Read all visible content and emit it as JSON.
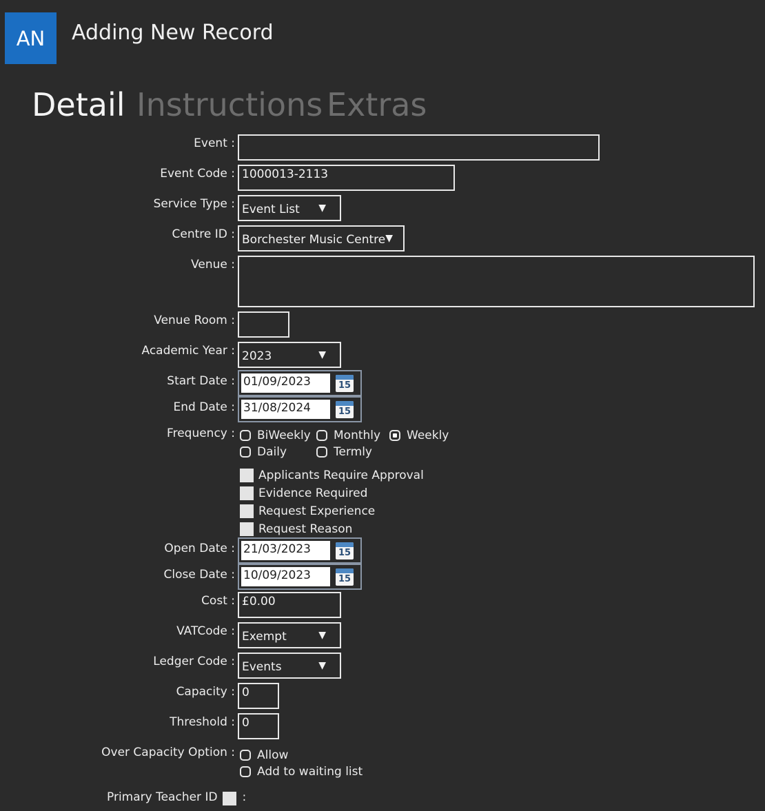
{
  "header": {
    "avatar_initials": "AN",
    "title": "Adding New Record"
  },
  "tabs": {
    "detail": "Detail",
    "instructions": "Instructions",
    "extras": "Extras"
  },
  "form": {
    "event": {
      "label": "Event :",
      "value": ""
    },
    "event_code": {
      "label": "Event Code :",
      "value": "1000013-2113"
    },
    "service_type": {
      "label": "Service Type :",
      "value": "Event List"
    },
    "centre_id": {
      "label": "Centre ID :",
      "value": "Borchester Music Centre"
    },
    "venue": {
      "label": "Venue :",
      "value": ""
    },
    "venue_room": {
      "label": "Venue Room :",
      "value": ""
    },
    "academic_year": {
      "label": "Academic Year :",
      "value": "2023"
    },
    "start_date": {
      "label": "Start Date :",
      "value": "01/09/2023"
    },
    "end_date": {
      "label": "End Date :",
      "value": "31/08/2024"
    },
    "frequency": {
      "label": "Frequency :",
      "options": [
        "BiWeekly",
        "Monthly",
        "Weekly",
        "Daily",
        "Termly"
      ],
      "selected": "Weekly"
    },
    "checkboxes": {
      "applicants_require_approval": "Applicants Require Approval",
      "evidence_required": "Evidence Required",
      "request_experience": "Request Experience",
      "request_reason": "Request Reason"
    },
    "open_date": {
      "label": "Open Date :",
      "value": "21/03/2023"
    },
    "close_date": {
      "label": "Close Date :",
      "value": "10/09/2023"
    },
    "cost": {
      "label": "Cost :",
      "value": "£0.00"
    },
    "vat_code": {
      "label": "VATCode :",
      "value": "Exempt"
    },
    "ledger_code": {
      "label": "Ledger Code :",
      "value": "Events"
    },
    "capacity": {
      "label": "Capacity :",
      "value": "0"
    },
    "threshold": {
      "label": "Threshold :",
      "value": "0"
    },
    "over_capacity": {
      "label": "Over Capacity Option :",
      "options": [
        "Allow",
        "Add to waiting list"
      ]
    },
    "primary_teacher": {
      "label": "Primary Teacher ID",
      "colon": ":"
    },
    "calendar_icon_number": "15",
    "dropdown_arrow": "▼"
  }
}
